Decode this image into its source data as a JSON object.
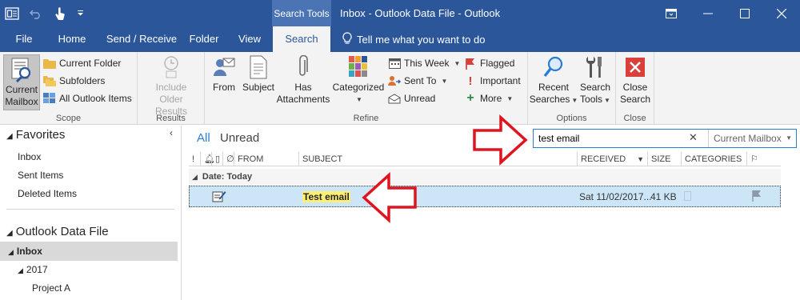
{
  "window": {
    "title": "Inbox - Outlook Data File  -  Outlook",
    "contextual_tab_group": "Search Tools"
  },
  "tabs": [
    {
      "label": "File"
    },
    {
      "label": "Home"
    },
    {
      "label": "Send / Receive"
    },
    {
      "label": "Folder"
    },
    {
      "label": "View"
    },
    {
      "label": "Search",
      "active": true
    }
  ],
  "tell_me": "Tell me what you want to do",
  "ribbon": {
    "scope": {
      "group_label": "Scope",
      "current_mailbox_line1": "Current",
      "current_mailbox_line2": "Mailbox",
      "current_folder": "Current Folder",
      "subfolders": "Subfolders",
      "all_outlook_items": "All Outlook Items"
    },
    "results": {
      "group_label": "Results",
      "include_line1": "Include",
      "include_line2": "Older Results"
    },
    "refine": {
      "group_label": "Refine",
      "from": "From",
      "subject": "Subject",
      "has_line1": "Has",
      "has_line2": "Attachments",
      "categorized": "Categorized",
      "this_week": "This Week",
      "sent_to": "Sent To",
      "unread": "Unread",
      "flagged": "Flagged",
      "important": "Important",
      "more": "More"
    },
    "options": {
      "group_label": "Options",
      "recent_line1": "Recent",
      "recent_line2": "Searches",
      "tools_line1": "Search",
      "tools_line2": "Tools"
    },
    "close": {
      "group_label": "Close",
      "close_line1": "Close",
      "close_line2": "Search"
    }
  },
  "nav": {
    "favorites_header": "Favorites",
    "favorites": [
      "Inbox",
      "Sent Items",
      "Deleted Items"
    ],
    "datafile_header": "Outlook Data File",
    "inbox": "Inbox",
    "year": "2017",
    "project": "Project A"
  },
  "list": {
    "filter_all": "All",
    "filter_unread": "Unread",
    "search_value": "test email",
    "search_scope": "Current Mailbox",
    "columns": {
      "from": "FROM",
      "subject": "SUBJECT",
      "received": "RECEIVED",
      "size": "SIZE",
      "categories": "CATEGORIES"
    },
    "group_header": "Date: Today",
    "mail": {
      "subject": "Test email",
      "received": "Sat 11/02/2017...",
      "size": "41 KB"
    }
  },
  "colors": {
    "titlebar": "#2b579a",
    "ribbon": "#f3f3f3",
    "selected_row": "#cde6f7",
    "highlight": "#ffef74",
    "annotation_arrow": "#e0141e"
  }
}
